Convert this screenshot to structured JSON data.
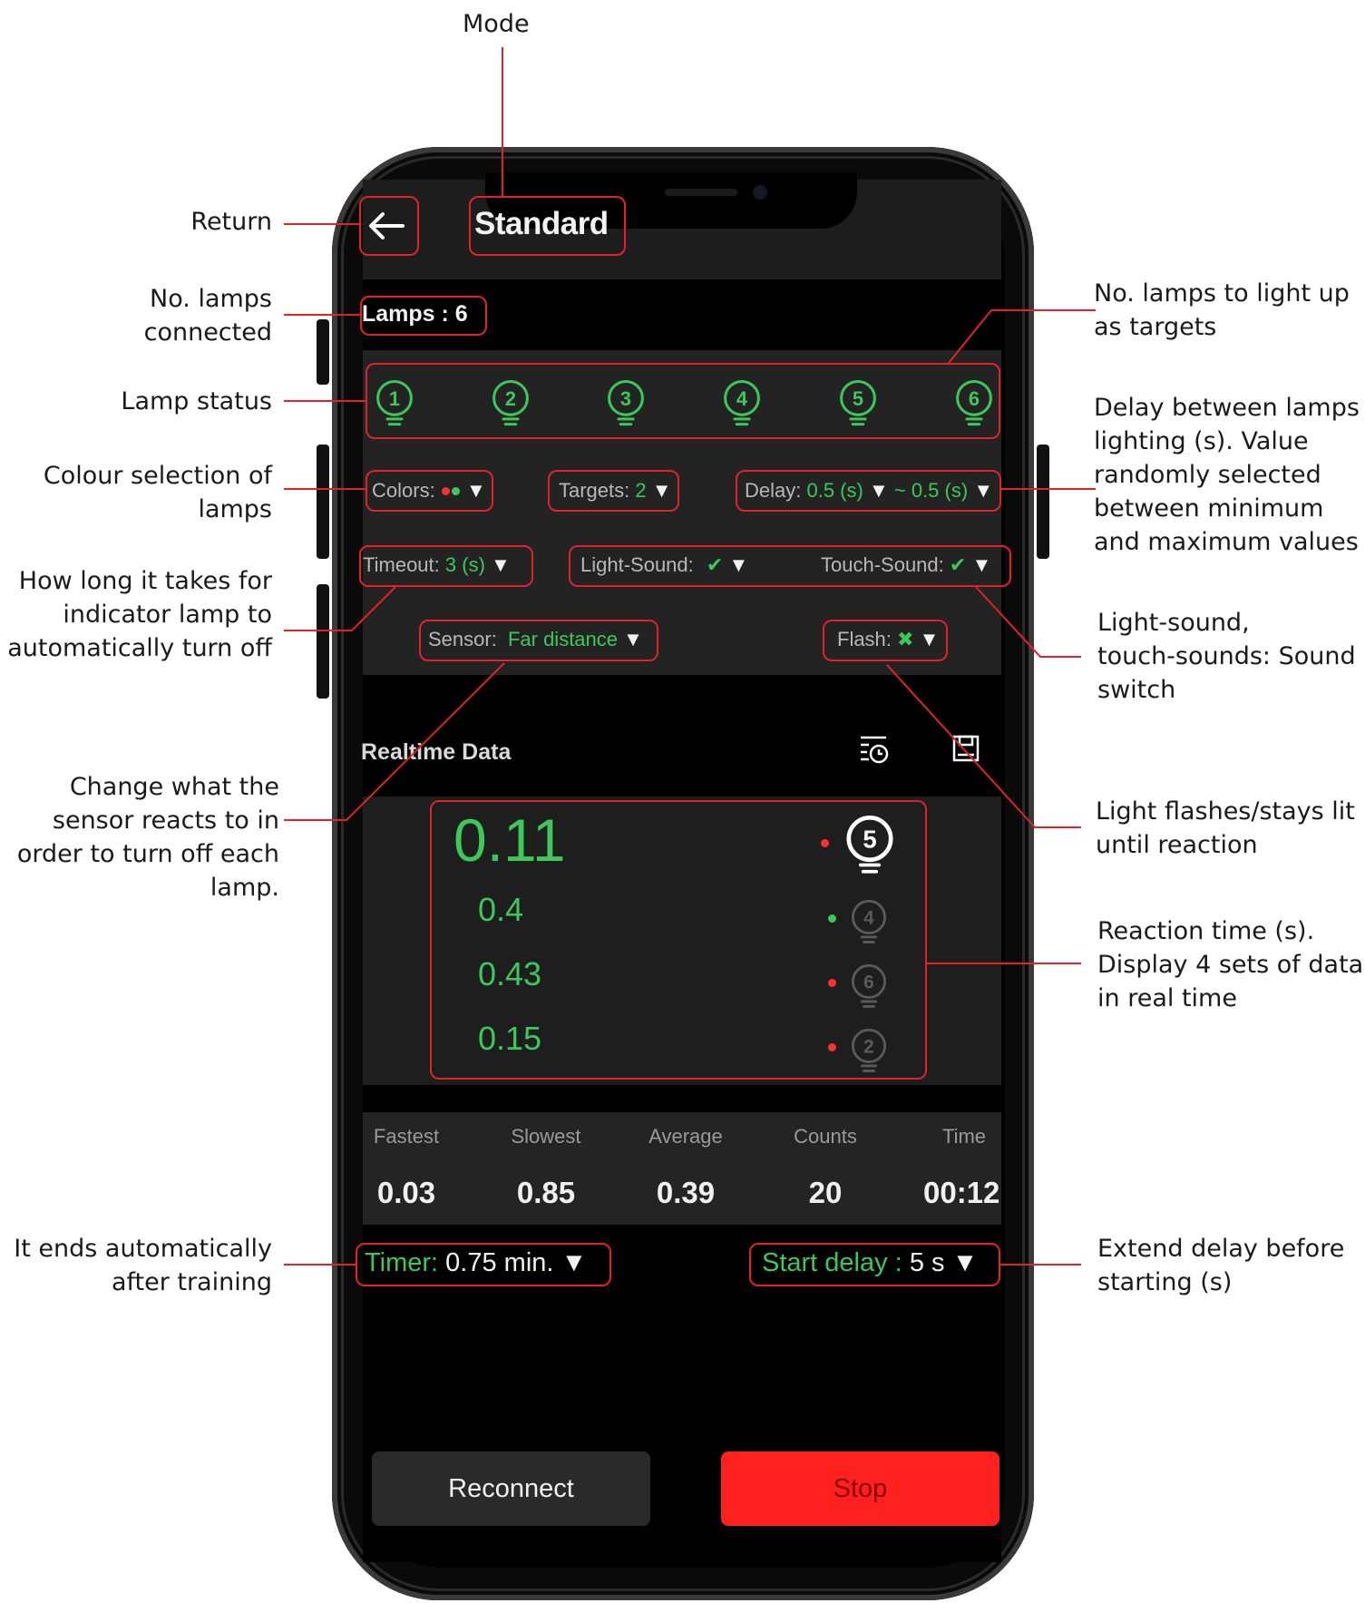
{
  "annotations": {
    "mode": "Mode",
    "return": "Return",
    "lamps_connected": [
      "No. lamps",
      "connected"
    ],
    "lamp_status": "Lamp status",
    "colour_selection": [
      "Colour selection of",
      "lamps"
    ],
    "timeout": [
      "How long it takes for",
      "indicator lamp to",
      "automatically turn off"
    ],
    "sensor": [
      "Change what the",
      "sensor reacts to in",
      "order to turn off each",
      "lamp."
    ],
    "timer": [
      "It ends automatically",
      "after training"
    ],
    "targets": [
      "No. lamps to light up",
      "as targets"
    ],
    "delay": [
      "Delay between lamps",
      "lighting (s). Value",
      "randomly selected",
      "between minimum",
      "and maximum values"
    ],
    "sounds": [
      "Light-sound,",
      "touch-sounds: Sound",
      "switch"
    ],
    "flash": [
      "Light flashes/stays lit",
      "until reaction"
    ],
    "reaction": [
      "Reaction time (s).",
      "Display 4 sets of data",
      "in real time"
    ],
    "start_delay": [
      "Extend delay before",
      "starting (s)"
    ]
  },
  "app": {
    "title": "Standard",
    "lamps_label": "Lamps : 6",
    "lamps": [
      "1",
      "2",
      "3",
      "4",
      "5",
      "6"
    ],
    "colors_label": "Colors:",
    "colors": [
      "#ff3030",
      "#3cc85a"
    ],
    "targets_label": "Targets:",
    "targets_value": "2",
    "delay_label": "Delay:",
    "delay_min": "0.5 (s)",
    "delay_max": "~ 0.5 (s)",
    "timeout_label": "Timeout:",
    "timeout_value": "3 (s)",
    "light_sound_label": "Light-Sound:",
    "light_sound_value": "✔",
    "touch_sound_label": "Touch-Sound:",
    "touch_sound_value": "✔",
    "sensor_label": "Sensor:",
    "sensor_value": "Far distance",
    "flash_label": "Flash:",
    "flash_value": "✖",
    "realtime_title": "Realtime Data",
    "realtime": [
      {
        "value": "0.11",
        "lamp": "5",
        "dot": "#ff3030"
      },
      {
        "value": "0.4",
        "lamp": "4",
        "dot": "#3cc85a"
      },
      {
        "value": "0.43",
        "lamp": "6",
        "dot": "#ff3030"
      },
      {
        "value": "0.15",
        "lamp": "2",
        "dot": "#ff3030"
      }
    ],
    "stats": [
      {
        "label": "Fastest",
        "value": "0.03"
      },
      {
        "label": "Slowest",
        "value": "0.85"
      },
      {
        "label": "Average",
        "value": "0.39"
      },
      {
        "label": "Counts",
        "value": "20"
      },
      {
        "label": "Time",
        "value": "00:12"
      }
    ],
    "timer_label": "Timer:",
    "timer_value": "0.75 min.",
    "start_delay_label": "Start delay :",
    "start_delay_value": "5 s",
    "reconnect_label": "Reconnect",
    "stop_label": "Stop"
  },
  "colors": {
    "accent_green": "#3cc85a",
    "highlight_red": "#e2222a",
    "stop_red": "#ff2020"
  }
}
